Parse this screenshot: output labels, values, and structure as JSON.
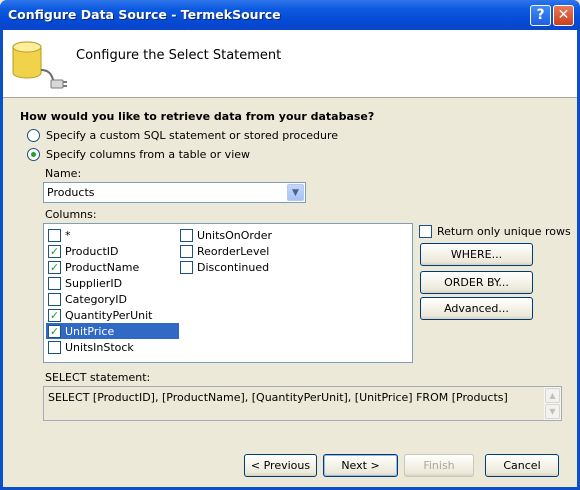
{
  "window": {
    "title": "Configure Data Source - TermekSource",
    "help_label": "?",
    "close_label": "✕"
  },
  "header": {
    "title": "Configure the Select Statement",
    "icon": "database-plug-icon"
  },
  "question": "How would you like to retrieve data from your database?",
  "options": {
    "custom_sql": {
      "label": "Specify a custom SQL statement or stored procedure",
      "selected": false
    },
    "columns": {
      "label": "Specify columns from a table or view",
      "selected": true
    }
  },
  "name": {
    "label": "Name:",
    "value": "Products"
  },
  "columns": {
    "label": "Columns:",
    "items_col1": [
      {
        "label": "*",
        "checked": false,
        "selected": false
      },
      {
        "label": "ProductID",
        "checked": true,
        "selected": false
      },
      {
        "label": "ProductName",
        "checked": true,
        "selected": false
      },
      {
        "label": "SupplierID",
        "checked": false,
        "selected": false
      },
      {
        "label": "CategoryID",
        "checked": false,
        "selected": false
      },
      {
        "label": "QuantityPerUnit",
        "checked": true,
        "selected": false
      },
      {
        "label": "UnitPrice",
        "checked": true,
        "selected": true
      },
      {
        "label": "UnitsInStock",
        "checked": false,
        "selected": false
      }
    ],
    "items_col2": [
      {
        "label": "UnitsOnOrder",
        "checked": false,
        "selected": false
      },
      {
        "label": "ReorderLevel",
        "checked": false,
        "selected": false
      },
      {
        "label": "Discontinued",
        "checked": false,
        "selected": false
      }
    ]
  },
  "side": {
    "unique_rows_label": "Return only unique rows",
    "unique_rows_checked": false,
    "where_label": "WHERE...",
    "orderby_label": "ORDER BY...",
    "advanced_label": "Advanced..."
  },
  "select_statement": {
    "label": "SELECT statement:",
    "value": "SELECT [ProductID], [ProductName], [QuantityPerUnit], [UnitPrice] FROM [Products]"
  },
  "footer": {
    "previous_label": "< Previous",
    "next_label": "Next >",
    "finish_label": "Finish",
    "cancel_label": "Cancel"
  }
}
